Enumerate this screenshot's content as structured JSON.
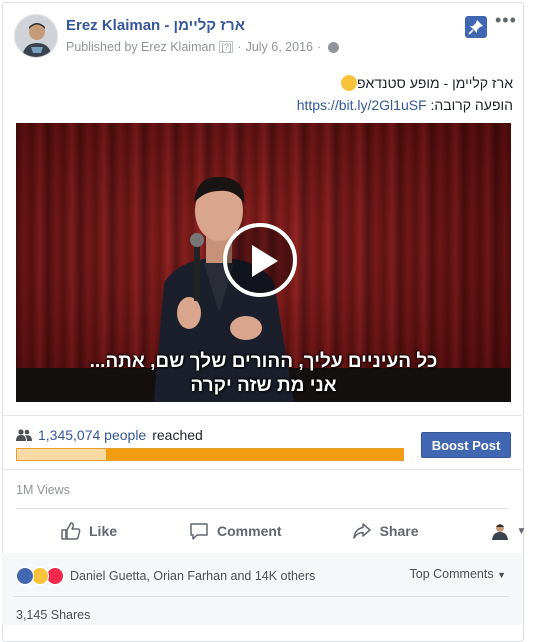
{
  "post": {
    "page_name": "Erez Klaiman - ארז קליימן",
    "published_by": "Published by Erez Klaiman",
    "help_mark": "[?]",
    "separator": "·",
    "date": "July 6, 2016",
    "text_line1": "ארז קליימן - מופע סטנדאפ",
    "text_line2_prefix": "הופעה קרובה:",
    "link": "https://bit.ly/2Gl1uSF"
  },
  "video": {
    "subtitle_line1": "כל העיניים עליך, ההורים שלך שם, אתה...",
    "subtitle_line2": "אני מת שזה יקרה"
  },
  "insights": {
    "reach_count": "1,345,074 people",
    "reach_suffix": "reached",
    "boost_label": "Boost Post",
    "reach_bar_fraction": 0.23,
    "views": "1M Views"
  },
  "actions": {
    "like": "Like",
    "comment": "Comment",
    "share": "Share"
  },
  "footer": {
    "reaction_names": "Daniel Guetta, Orian Farhan and 14K others",
    "top_comments": "Top Comments",
    "shares": "3,145 Shares"
  },
  "colors": {
    "link_blue": "#365899",
    "boost_blue": "#4267b2",
    "reach_bar": "#f39c12"
  }
}
